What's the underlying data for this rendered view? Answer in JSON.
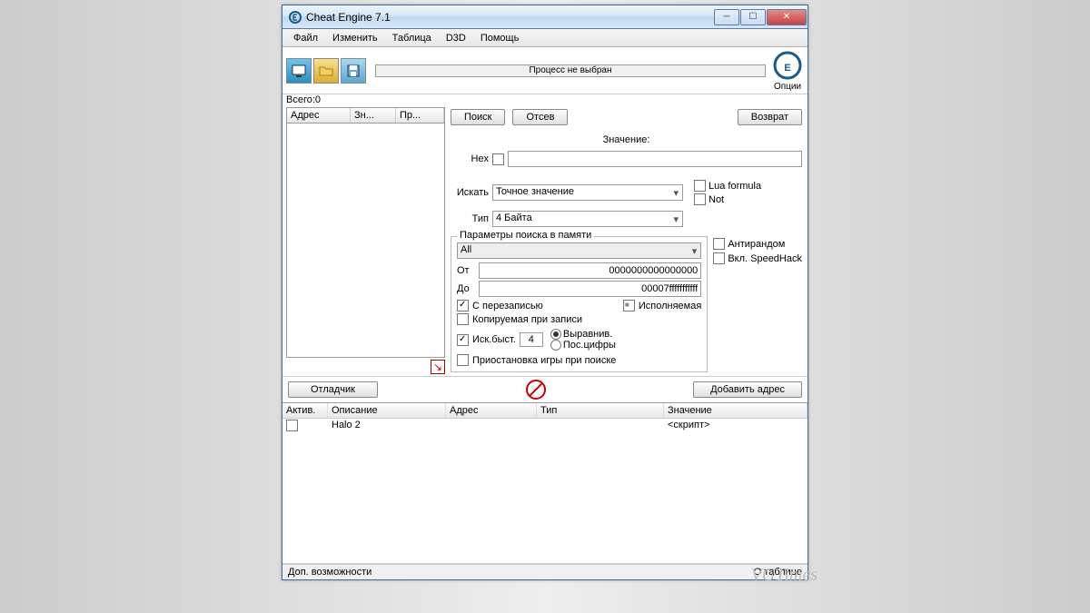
{
  "title": "Cheat Engine 7.1",
  "menu": [
    "Файл",
    "Изменить",
    "Таблица",
    "D3D",
    "Помощь"
  ],
  "process_status": "Процесс не выбран",
  "options_label": "Опции",
  "count_label": "Всего:",
  "count_value": "0",
  "results_cols": [
    "Адрес",
    "Зн...",
    "Пр..."
  ],
  "buttons": {
    "search": "Поиск",
    "filter": "Отсев",
    "undo": "Возврат",
    "debugger": "Отладчик",
    "add_addr": "Добавить адрес"
  },
  "value_label": "Значение:",
  "hex_label": "Hex",
  "search_label": "Искать",
  "search_mode": "Точное значение",
  "type_label": "Тип",
  "type_value": "4 Байта",
  "lua_label": "Lua formula",
  "not_label": "Not",
  "mem_group": "Параметры поиска в памяти",
  "mem_scope": "All",
  "from_label": "От",
  "from_value": "0000000000000000",
  "to_label": "До",
  "to_value": "00007fffffffffff",
  "writable": "С перезаписью",
  "executable": "Исполняемая",
  "cow": "Копируемая при записи",
  "antirandom": "Антирандом",
  "speedhack": "Вкл. SpeedHack",
  "fastscan": "Иск.быст.",
  "fastscan_val": "4",
  "align": "Выравнив.",
  "lastdigits": "Пос.цифры",
  "pause_game": "Приостановка игры при поиске",
  "addr_cols": {
    "active": "Актив.",
    "desc": "Описание",
    "addr": "Адрес",
    "type": "Тип",
    "value": "Значение"
  },
  "addr_row": {
    "desc": "Halo 2",
    "value": "<скрипт>"
  },
  "status_left": "Доп. возможности",
  "status_right": "О таблице",
  "watermark": "VGTimes"
}
